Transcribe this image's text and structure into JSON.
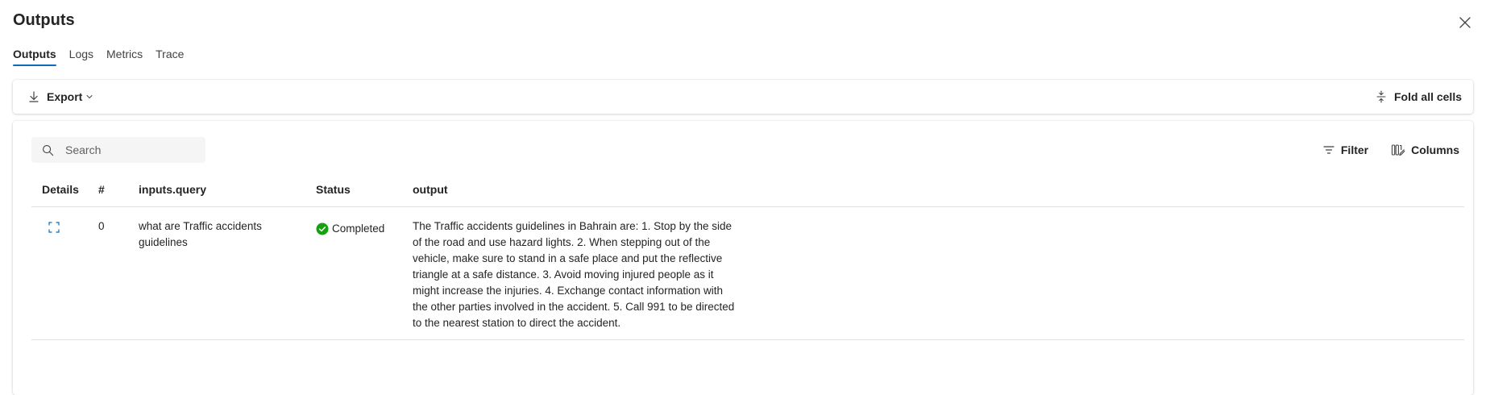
{
  "header": {
    "title": "Outputs"
  },
  "tabs": [
    {
      "label": "Outputs",
      "active": true
    },
    {
      "label": "Logs",
      "active": false
    },
    {
      "label": "Metrics",
      "active": false
    },
    {
      "label": "Trace",
      "active": false
    }
  ],
  "toolbar": {
    "export_label": "Export",
    "fold_label": "Fold all cells"
  },
  "search": {
    "placeholder": "Search"
  },
  "actions": {
    "filter_label": "Filter",
    "columns_label": "Columns"
  },
  "table": {
    "columns": [
      "Details",
      "#",
      "inputs.query",
      "Status",
      "output"
    ],
    "rows": [
      {
        "index": "0",
        "query": "what are Traffic accidents guidelines",
        "status": "Completed",
        "output": "The Traffic accidents guidelines in Bahrain are: 1. Stop by the side of the road and use hazard lights. 2. When stepping out of the vehicle, make sure to stand in a safe place and put the reflective triangle at a safe distance. 3. Avoid moving injured people as it might increase the injuries. 4. Exchange contact information with the other parties involved in the accident. 5. Call 991 to be directed to the nearest station to direct the accident."
      }
    ]
  },
  "colors": {
    "accent": "#0f6cbd",
    "success": "#13a10e"
  }
}
